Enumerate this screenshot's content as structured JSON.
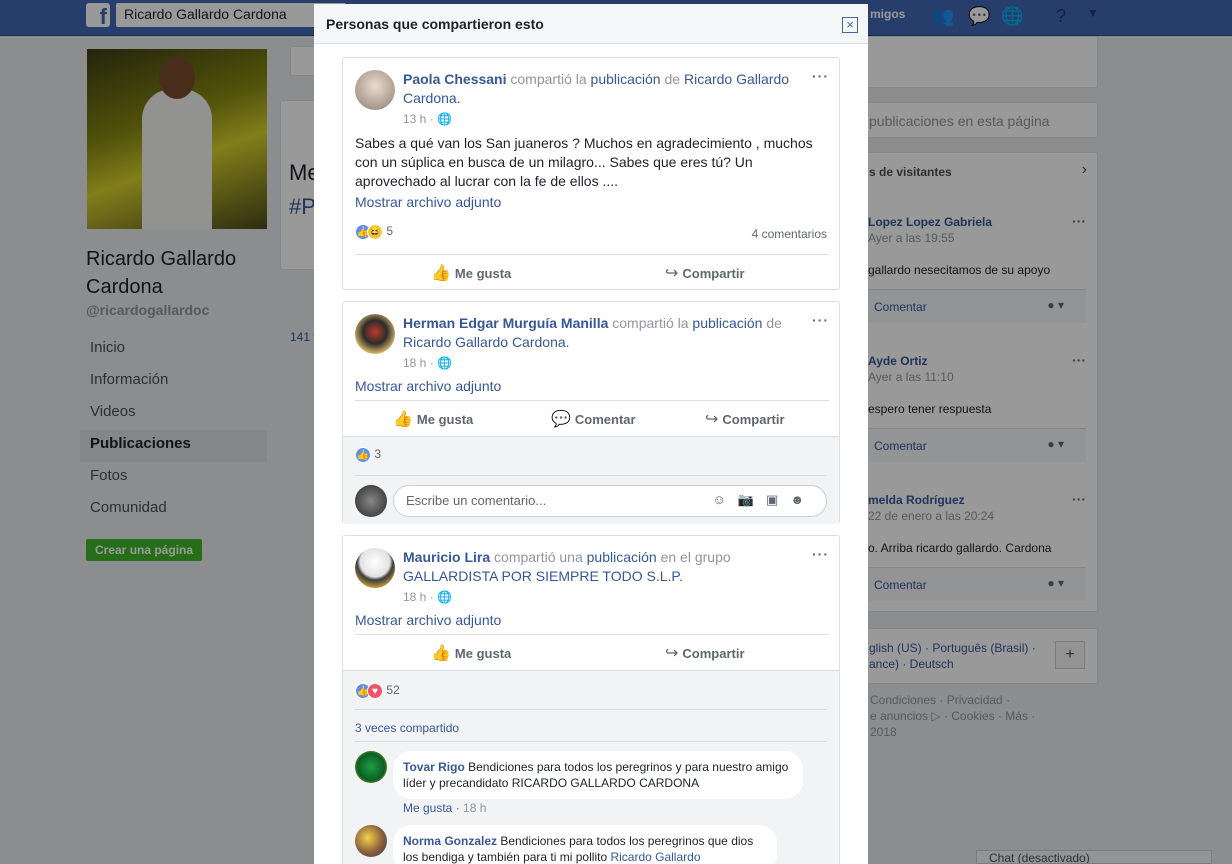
{
  "topbar": {
    "search_value": "Ricardo Gallardo Cardona",
    "friends_label": "migos"
  },
  "left": {
    "page_name": "Ricardo Gallardo Cardona",
    "handle": "@ricardogallardoc",
    "nav": [
      "Inicio",
      "Información",
      "Videos",
      "Publicaciones",
      "Fotos",
      "Comunidad"
    ],
    "create_page": "Crear una página"
  },
  "background_center": {
    "partial_title_1": "Me",
    "partial_title_2": "#P",
    "count_partial": "141 v"
  },
  "right": {
    "search_placeholder": "publicaciones en esta página",
    "visitors_header": "s de visitantes",
    "posts": [
      {
        "name": "Lopez Lopez Gabriela",
        "time": "Ayer a las 19:55",
        "text": "gallardo nesecitamos de su apoyo",
        "comment": "Comentar"
      },
      {
        "name": "Ayde Ortiz",
        "time": "Ayer a las 11:10",
        "text": "espero tener respuesta",
        "comment": "Comentar"
      },
      {
        "name": "melda Rodríguez",
        "time": "22 de enero a las 20:24",
        "text": "o. Arriba ricardo gallardo. Cardona",
        "comment": "Comentar"
      }
    ],
    "languages_1": "glish (US) · Português (Brasil) ·",
    "languages_2": "ance) · Deutsch",
    "footer_1": "Condiciones · Privacidad ·",
    "footer_2": "e anuncios ▷ · Cookies · Más ·",
    "footer_3": "2018",
    "chat": "Chat (desactivado)"
  },
  "modal": {
    "title": "Personas que compartieron esto",
    "close": "×",
    "shares": [
      {
        "name": "Paola Chessani",
        "verb": " compartió la ",
        "object": "publicación",
        "prep": " de ",
        "target": "Ricardo Gallardo Cardona.",
        "time": "13 h",
        "text": "Sabes a qué van los San juaneros ? Muchos en agradecimiento , muchos con un súplica en busca de un milagro... Sabes que eres tú? Un aprovechado al lucrar con la fe de ellos ....",
        "attachment": "Mostrar archivo adjunto",
        "reactions": "5",
        "comments": "4 comentarios",
        "like": "Me gusta",
        "share": "Compartir"
      },
      {
        "name": "Herman Edgar Murguía Manilla",
        "verb": " compartió la ",
        "object": "publicación",
        "prep": " de ",
        "target": "Ricardo Gallardo Cardona.",
        "time": "18 h",
        "attachment": "Mostrar archivo adjunto",
        "reactions": "3",
        "like": "Me gusta",
        "comment": "Comentar",
        "share": "Compartir",
        "comment_placeholder": "Escribe un comentario..."
      },
      {
        "name": "Mauricio Lira",
        "verb": " compartió una ",
        "object": "publicación",
        "prep": " en el grupo ",
        "target": "GALLARDISTA POR SIEMPRE TODO S.L.P.",
        "time": "18 h",
        "attachment": "Mostrar archivo adjunto",
        "reactions": "52",
        "like": "Me gusta",
        "share": "Compartir",
        "shared_times": "3 veces compartido",
        "comments": [
          {
            "name": "Tovar Rigo",
            "text": "Bendiciones para todos los peregrinos y para nuestro amigo líder y precandidato RICARDO GALLARDO CARDONA",
            "like": "Me gusta",
            "time": "18 h"
          },
          {
            "name": "Norma Gonzalez",
            "text": "Bendiciones para todos los peregrinos que dios los bendiga y también para ti mi pollito ",
            "link": "Ricardo Gallardo"
          }
        ]
      }
    ]
  }
}
